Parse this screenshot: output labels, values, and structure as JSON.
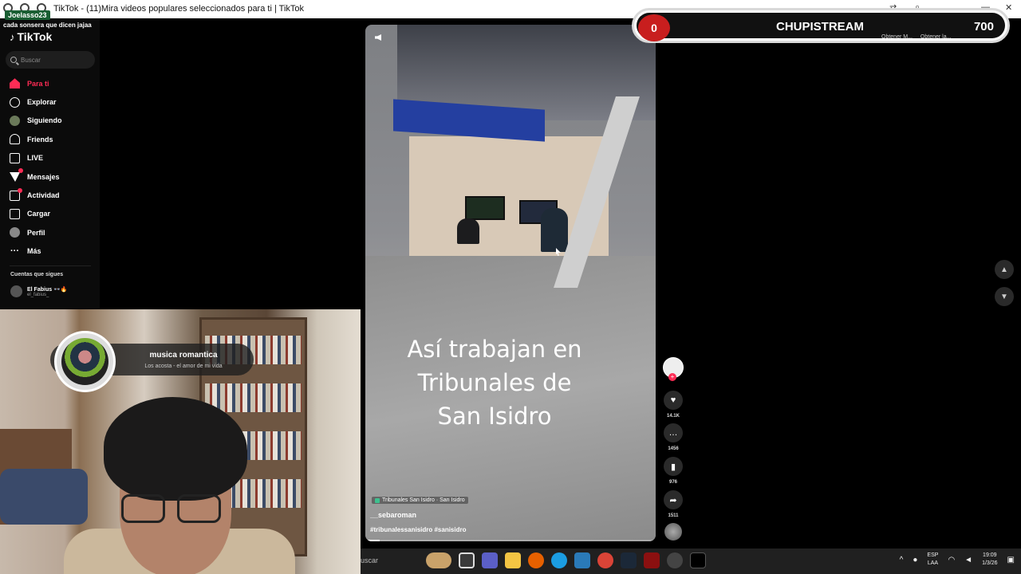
{
  "window": {
    "title": "TikTok - (11)Mira videos populares seleccionados para ti | TikTok",
    "minimize": "—",
    "maximize": "□",
    "close": "✕"
  },
  "chat": {
    "user": "Joelasso23",
    "message": "cada sonsera que dicen jajaa"
  },
  "sidebar": {
    "logo": "TikTok",
    "search_placeholder": "Buscar",
    "items": [
      {
        "label": "Para ti",
        "icon": "home-icon",
        "active": true
      },
      {
        "label": "Explorar",
        "icon": "compass-icon"
      },
      {
        "label": "Siguiendo",
        "icon": "following-avatar-icon"
      },
      {
        "label": "Friends",
        "icon": "friends-icon"
      },
      {
        "label": "LIVE",
        "icon": "live-icon"
      },
      {
        "label": "Mensajes",
        "icon": "messages-icon",
        "badge": true
      },
      {
        "label": "Actividad",
        "icon": "activity-icon",
        "badge": true
      },
      {
        "label": "Cargar",
        "icon": "upload-icon"
      },
      {
        "label": "Perfil",
        "icon": "profile-icon"
      },
      {
        "label": "Más",
        "icon": "more-icon"
      }
    ],
    "following_title": "Cuentas que sigues",
    "following": [
      {
        "name": "El Fabius 👓🔥",
        "handle": "el_fabius_"
      }
    ]
  },
  "music": {
    "title": "musica romantica",
    "artist": "Los acosta - el amor de mi vida"
  },
  "video": {
    "caption": [
      "Así trabajan en",
      "Tribunales de",
      "San Isidro"
    ],
    "location": "Tribunales San Isidro · San Isidro",
    "author": "__sebaroman",
    "hashtags": "#tribunalessanisidro #sanisidro",
    "progress": 0.05
  },
  "actions": {
    "likes": "14.1K",
    "comments": "1456",
    "saves": "976",
    "shares": "1511"
  },
  "stream": {
    "counter": "0",
    "name": "CHUPISTREAM",
    "points": "700",
    "extension_1": "Obtener M...",
    "extension_2": "Obtener la..."
  },
  "taskbar": {
    "search": "uscar",
    "lang_1": "ESP",
    "lang_2": "LAA",
    "time": "19:09",
    "date": "1/3/26"
  },
  "colors": {
    "accent": "#fe2c55",
    "stream_badge": "#c81e1e"
  }
}
